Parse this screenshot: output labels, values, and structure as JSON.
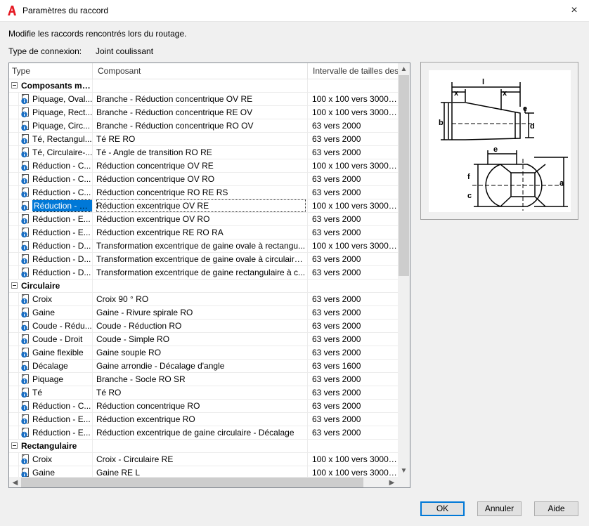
{
  "window": {
    "title": "Paramètres du raccord",
    "close_label": "×"
  },
  "description": "Modifie les raccords rencontrés lors du routage.",
  "connection": {
    "label": "Type de connexion:",
    "value": "Joint coulissant"
  },
  "grid": {
    "columns": [
      "Type",
      "Composant",
      "Intervalle de tailles des"
    ],
    "rows": [
      {
        "group": true,
        "name": "Composants mu..."
      },
      {
        "type": "Piquage, Oval...",
        "comp": "Branche - Réduction concentrique OV RE",
        "range": "100 x 100 vers 3000 x 30"
      },
      {
        "type": "Piquage, Rect...",
        "comp": "Branche - Réduction concentrique RE OV",
        "range": "100 x 100 vers 3000 x 30"
      },
      {
        "type": "Piquage, Circ...",
        "comp": "Branche - Réduction concentrique RO OV",
        "range": "63 vers 2000"
      },
      {
        "type": "Té, Rectangul...",
        "comp": "Té RE RO",
        "range": "63 vers 2000"
      },
      {
        "type": "Té, Circulaire-...",
        "comp": "Té - Angle de transition RO RE",
        "range": "63 vers 2000"
      },
      {
        "type": "Réduction - C...",
        "comp": "Réduction concentrique OV RE",
        "range": "100 x 100 vers 3000 x 30"
      },
      {
        "type": "Réduction - C...",
        "comp": "Réduction concentrique OV RO",
        "range": "63 vers 2000"
      },
      {
        "type": "Réduction - C...",
        "comp": "Réduction concentrique RO RE RS",
        "range": "63 vers 2000"
      },
      {
        "type": "Réduction - E...",
        "comp": "Réduction excentrique OV RE",
        "range": "100 x 100 vers 3000 x 30",
        "selected": true
      },
      {
        "type": "Réduction - E...",
        "comp": "Réduction excentrique OV RO",
        "range": "63 vers 2000"
      },
      {
        "type": "Réduction - E...",
        "comp": "Réduction excentrique RE RO RA",
        "range": "63 vers 2000"
      },
      {
        "type": "Réduction - D...",
        "comp": "Transformation excentrique de gaine ovale à rectangu...",
        "range": "100 x 100 vers 3000 x 30"
      },
      {
        "type": "Réduction - D...",
        "comp": "Transformation excentrique de gaine ovale à circulaire...",
        "range": "63 vers 2000"
      },
      {
        "type": "Réduction - D...",
        "comp": "Transformation excentrique de gaine rectangulaire à c...",
        "range": "63 vers 2000"
      },
      {
        "group": true,
        "name": "Circulaire"
      },
      {
        "type": "Croix",
        "comp": "Croix 90 ° RO",
        "range": "63 vers 2000"
      },
      {
        "type": "Gaine",
        "comp": "Gaine - Rivure spirale RO",
        "range": "63 vers 2000"
      },
      {
        "type": "Coude - Rédu...",
        "comp": "Coude - Réduction RO",
        "range": "63 vers 2000"
      },
      {
        "type": "Coude - Droit",
        "comp": "Coude - Simple RO",
        "range": "63 vers 2000"
      },
      {
        "type": "Gaine flexible",
        "comp": "Gaine souple RO",
        "range": "63 vers 2000"
      },
      {
        "type": "Décalage",
        "comp": "Gaine arrondie - Décalage d'angle",
        "range": "63 vers 1600"
      },
      {
        "type": "Piquage",
        "comp": "Branche - Socle RO SR",
        "range": "63 vers 2000"
      },
      {
        "type": "Té",
        "comp": "Té RO",
        "range": "63 vers 2000"
      },
      {
        "type": "Réduction - C...",
        "comp": "Réduction concentrique RO",
        "range": "63 vers 2000"
      },
      {
        "type": "Réduction - E...",
        "comp": "Réduction excentrique RO",
        "range": "63 vers 2000"
      },
      {
        "type": "Réduction - E...",
        "comp": "Réduction excentrique de gaine circulaire - Décalage",
        "range": "63 vers 2000"
      },
      {
        "group": true,
        "name": "Rectangulaire"
      },
      {
        "type": "Croix",
        "comp": "Croix - Circulaire RE",
        "range": "100 x 100 vers 3000 x 30"
      },
      {
        "type": "Gaine",
        "comp": "Gaine RE L",
        "range": "100 x 100 vers 3000 x 30"
      }
    ]
  },
  "preview": {
    "labels": {
      "l": "l",
      "x1": "x",
      "x2": "x",
      "b": "b",
      "d": "d",
      "e1": "e",
      "e2": "e",
      "f": "f",
      "c": "c",
      "a": "a"
    }
  },
  "buttons": {
    "ok": "OK",
    "cancel": "Annuler",
    "help": "Aide"
  },
  "icons": {
    "app": "autocad-logo-icon",
    "fitting": "fitting-info-icon"
  },
  "colors": {
    "accent": "#0078d7",
    "logo": "#e51b24",
    "info": "#1a6fc4"
  }
}
